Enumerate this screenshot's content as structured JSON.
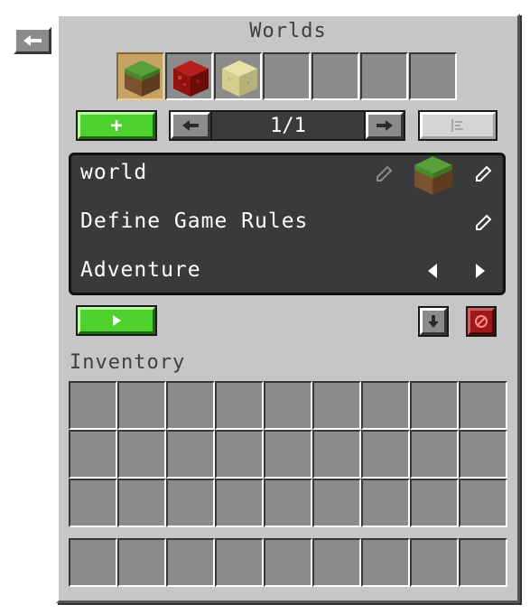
{
  "title": "Worlds",
  "worlds": [
    {
      "icon": "grass-block-icon",
      "selected": true
    },
    {
      "icon": "redstone-block-icon",
      "selected": false
    },
    {
      "icon": "end-stone-block-icon",
      "selected": false
    },
    {
      "icon": "empty",
      "selected": false
    },
    {
      "icon": "empty",
      "selected": false
    },
    {
      "icon": "empty",
      "selected": false
    },
    {
      "icon": "empty",
      "selected": false
    }
  ],
  "toolbar": {
    "add_label": "+",
    "page_indicator": "1/1",
    "prev_icon": "arrow-left-icon",
    "next_icon": "arrow-right-icon",
    "sort_icon": "sort-icon"
  },
  "settings": {
    "world_name": "world",
    "game_rules_label": "Define Game Rules",
    "game_mode": "Adventure"
  },
  "controls": {
    "play_icon": "play-icon",
    "download_icon": "download-icon",
    "delete_icon": "delete-icon"
  },
  "inventory": {
    "label": "Inventory",
    "rows": 3,
    "columns": 9,
    "hotbar_slots": 9
  },
  "colors": {
    "panel": "#c6c6c6",
    "slot": "#8b8b8b",
    "accent_green": "#4ed12e",
    "danger_red": "#9c1a1a",
    "settings_bg": "#3a3a3a"
  }
}
